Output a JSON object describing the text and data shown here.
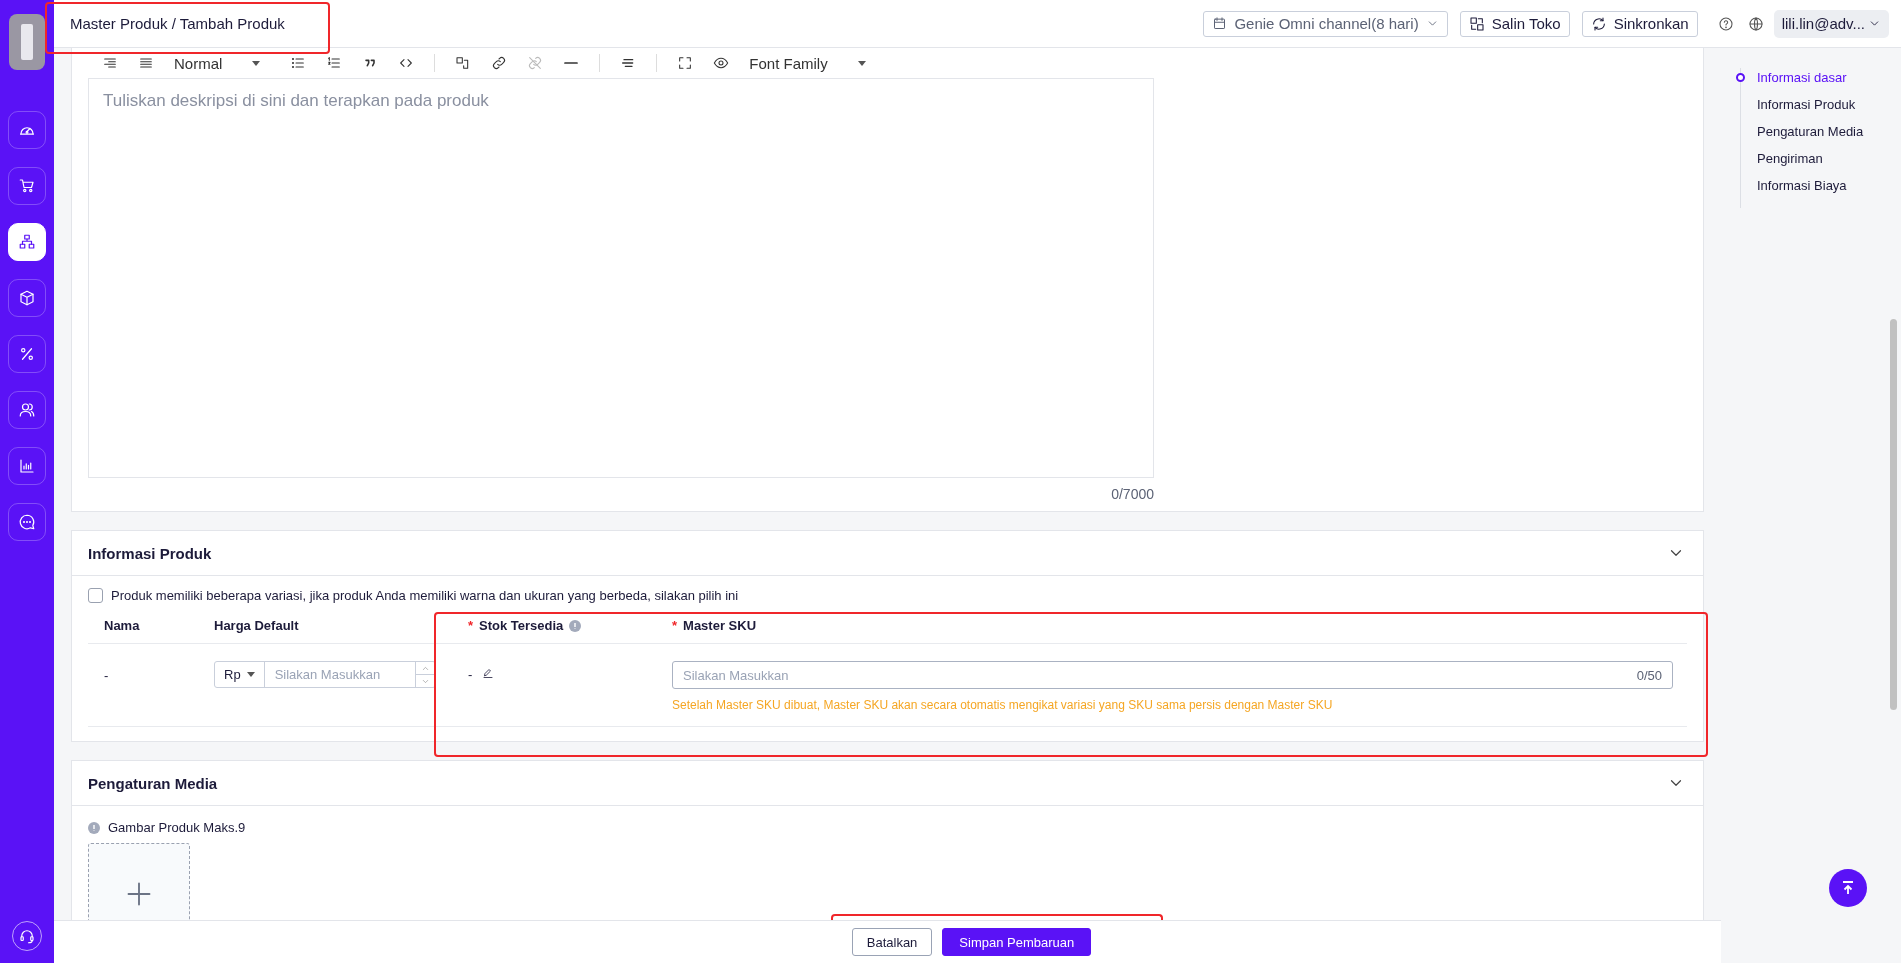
{
  "sidebar": {
    "items": [
      {
        "selected": false
      },
      {
        "selected": false
      },
      {
        "selected": true
      },
      {
        "selected": false
      },
      {
        "selected": false
      },
      {
        "selected": false
      },
      {
        "selected": false
      },
      {
        "selected": false
      }
    ]
  },
  "topbar": {
    "breadcrumb": [
      "Master Produk",
      "Tambah Produk"
    ],
    "separator": "/",
    "store_select": "Genie Omni channel(8 hari)",
    "buttons": [
      "Salin Toko",
      "Sinkronkan"
    ],
    "user": "lili.lin@adv..."
  },
  "editor": {
    "toolbar": {
      "heading": "Normal",
      "font_family": "Font Family"
    },
    "placeholder": "Tuliskan deskripsi di sini dan terapkan pada produk",
    "counter": "0/7000"
  },
  "product_info": {
    "title": "Informasi Produk",
    "expanded": true,
    "required_mark": "*",
    "variant_checkbox": {
      "label": "Produk memiliki beberapa variasi, jika produk Anda memiliki warna dan ukuran yang berbeda, silakan pilih ini",
      "checked": false
    },
    "columns": [
      {
        "label": "Nama",
        "required": false
      },
      {
        "label": "Harga Default",
        "required": false
      },
      {
        "label": "Stok Tersedia",
        "required": true
      },
      {
        "label": "Master SKU",
        "required": true
      }
    ],
    "rows": [
      {
        "name": "-",
        "currency": "Rp",
        "price_placeholder": "Silakan Masukkan",
        "stock": "-",
        "sku_placeholder": "Silakan Masukkan",
        "sku_counter": "0/50",
        "sku_hint": "Setelah Master SKU dibuat, Master SKU akan secara otomatis mengikat variasi yang SKU sama persis dengan Master SKU"
      }
    ]
  },
  "media": {
    "title": "Pengaturan Media",
    "expanded": true,
    "note": "Gambar Produk Maks.9"
  },
  "anchor_nav": {
    "items": [
      {
        "label": "Informasi dasar",
        "selected": true
      },
      {
        "label": "Informasi Produk",
        "selected": false
      },
      {
        "label": "Pengaturan Media",
        "selected": false
      },
      {
        "label": "Pengiriman",
        "selected": false
      },
      {
        "label": "Informasi Biaya",
        "selected": false
      }
    ]
  },
  "footer": {
    "buttons": [
      {
        "label": "Batalkan",
        "kind": "secondary"
      },
      {
        "label": "Simpan Pembaruan",
        "kind": "primary"
      }
    ]
  }
}
